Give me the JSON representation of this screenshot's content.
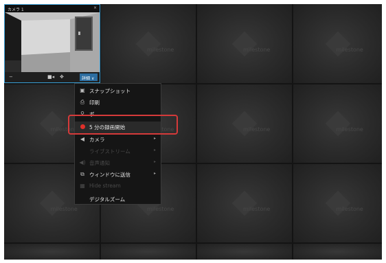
{
  "camera": {
    "title": "カメラ 1",
    "close_icon": "×",
    "toolbar": {
      "minus_icon": "−",
      "video_icon": "■◂",
      "ptz_icon": "✥",
      "more_label": "詳細",
      "more_chevron": "∨"
    }
  },
  "tile_watermark": "milestone",
  "menu": {
    "items": [
      {
        "label": "スナップショット",
        "icon": "camera-snapshot-icon",
        "glyph": "▣",
        "arrow": "",
        "enabled": true
      },
      {
        "label": "印刷",
        "icon": "printer-icon",
        "glyph": "⎙",
        "arrow": "",
        "enabled": true
      },
      {
        "label": "ボ",
        "icon": "pin-icon",
        "glyph": "⚲",
        "arrow": "",
        "enabled": true
      },
      {
        "label": "5 分の録画開始",
        "icon": "record-icon",
        "glyph": "",
        "arrow": "",
        "enabled": true
      },
      {
        "label": "カメラ",
        "icon": "camera-swap-icon",
        "glyph": "◀",
        "arrow": "▸",
        "enabled": true
      },
      {
        "label": "ライブストリーム",
        "icon": "stream-icon",
        "glyph": "",
        "arrow": "▸",
        "enabled": false
      },
      {
        "label": "音声通知",
        "icon": "speaker-icon",
        "glyph": "◀)",
        "arrow": "▸",
        "enabled": false
      },
      {
        "label": "ウィンドウに送信",
        "icon": "send-window-icon",
        "glyph": "⧉",
        "arrow": "▸",
        "enabled": true
      },
      {
        "label": "Hide stream",
        "icon": "hide-icon",
        "glyph": "▦",
        "arrow": "",
        "enabled": false
      },
      {
        "label": "デジタルズーム",
        "icon": "zoom-icon",
        "glyph": "",
        "arrow": "",
        "enabled": true
      }
    ]
  }
}
